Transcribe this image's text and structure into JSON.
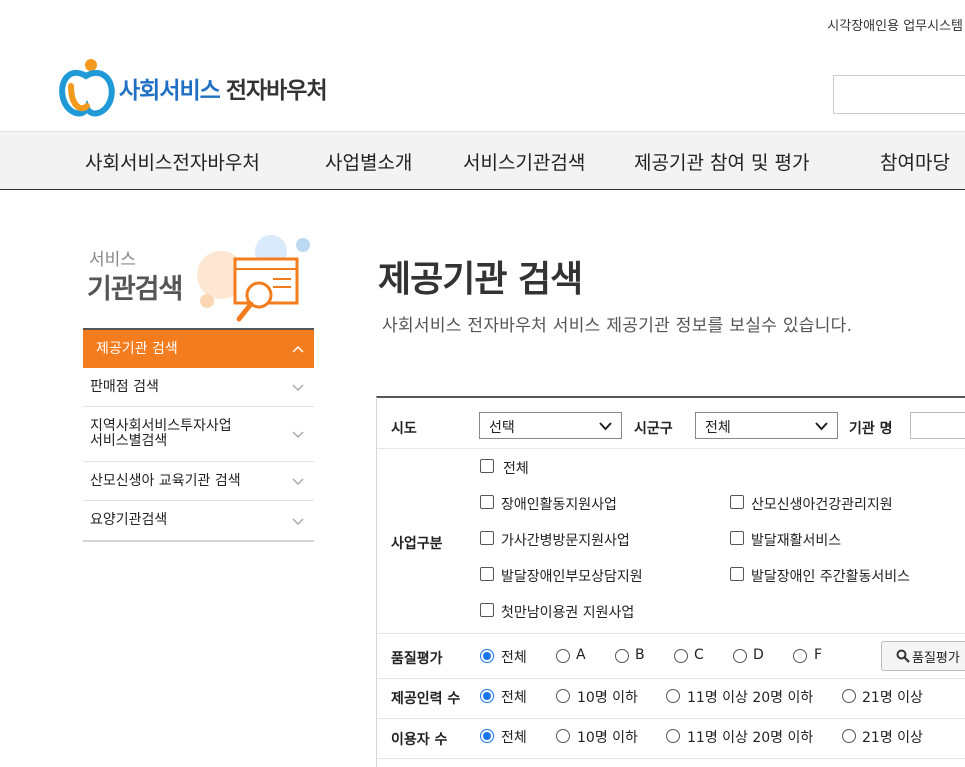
{
  "header": {
    "util_link": "시각장애인용 업무시스템",
    "logo_text_blue": "사회서비스",
    "logo_text_dark": "전자바우처"
  },
  "gnb": [
    "사회서비스전자바우처",
    "사업별소개",
    "서비스기관검색",
    "제공기관 참여 및 평가",
    "참여마당"
  ],
  "lnb": {
    "title_small": "서비스",
    "title_big": "기관검색",
    "items": [
      {
        "label": "제공기관 검색",
        "active": true
      },
      {
        "label": "판매점 검색"
      },
      {
        "label": "지역사회서비스투자사업\n서비스별검색"
      },
      {
        "label": "산모신생아 교육기관 검색"
      },
      {
        "label": "요양기관검색"
      }
    ]
  },
  "main": {
    "title": "제공기관 검색",
    "description": "사회서비스 전자바우처 서비스 제공기관 정보를 보실수 있습니다."
  },
  "form": {
    "sido_label": "시도",
    "sido_value": "선택",
    "sigungu_label": "시군구",
    "sigungu_value": "전체",
    "org_name_label": "기관 명",
    "business_label": "사업구분",
    "business_all": "전체",
    "business_options": [
      "장애인활동지원사업",
      "산모신생아건강관리지원",
      "가사간병방문지원사업",
      "발달재활서비스",
      "발달장애인부모상담지원",
      "발달장애인 주간활동서비스",
      "첫만남이용권 지원사업"
    ],
    "quality_label": "품질평가",
    "quality_options": [
      "전체",
      "A",
      "B",
      "C",
      "D",
      "F"
    ],
    "quality_selected": "전체",
    "quality_button": "품질평가",
    "staff_label": "제공인력 수",
    "staff_options": [
      "전체",
      "10명 이하",
      "11명 이상 20명 이하",
      "21명 이상"
    ],
    "staff_selected": "전체",
    "users_label": "이용자 수",
    "users_options": [
      "전체",
      "10명 이하",
      "11명 이상 20명 이하",
      "21명 이상"
    ],
    "users_selected": "전체"
  },
  "colors": {
    "brand_blue": "#1f6fc4",
    "accent_orange": "#f37c1e",
    "radio_blue": "#1a73e8"
  }
}
